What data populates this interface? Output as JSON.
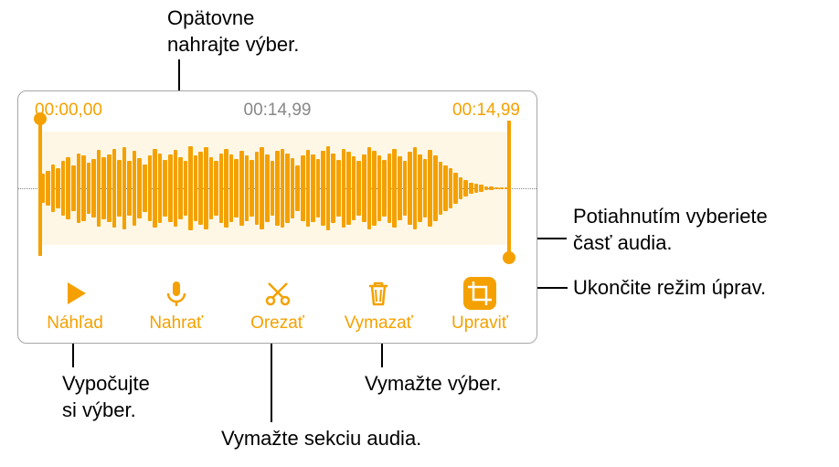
{
  "callouts": {
    "rerecord": "Opätovne\nnahrajte výber.",
    "drag": "Potiahnutím vyberiete\nčasť audia.",
    "done": "Ukončite režim úprav.",
    "preview": "Vypočujte\nsi výber.",
    "trim": "Vymažte sekciu audia.",
    "delete": "Vymažte výber."
  },
  "times": {
    "start": "00:00,00",
    "mid": "00:14,99",
    "end": "00:14,99"
  },
  "toolbar": {
    "preview": "Náhľad",
    "record": "Nahrať",
    "trim": "Orezať",
    "delete": "Vymazať",
    "edit": "Upraviť"
  },
  "colors": {
    "accent": "#f4a100"
  },
  "waveform_heights_pct": [
    26,
    30,
    42,
    35,
    48,
    55,
    40,
    62,
    58,
    45,
    52,
    68,
    55,
    60,
    70,
    50,
    72,
    48,
    66,
    54,
    42,
    58,
    70,
    62,
    50,
    60,
    68,
    55,
    48,
    74,
    58,
    64,
    72,
    55,
    48,
    62,
    70,
    60,
    52,
    66,
    58,
    50,
    64,
    72,
    60,
    48,
    66,
    70,
    62,
    54,
    40,
    58,
    68,
    60,
    52,
    66,
    74,
    62,
    50,
    70,
    64,
    56,
    48,
    60,
    72,
    66,
    58,
    50,
    62,
    70,
    56,
    48,
    64,
    72,
    60,
    52,
    68,
    58,
    46,
    40,
    36,
    28,
    20,
    14,
    10,
    8,
    6,
    4,
    3,
    2,
    2,
    2
  ]
}
